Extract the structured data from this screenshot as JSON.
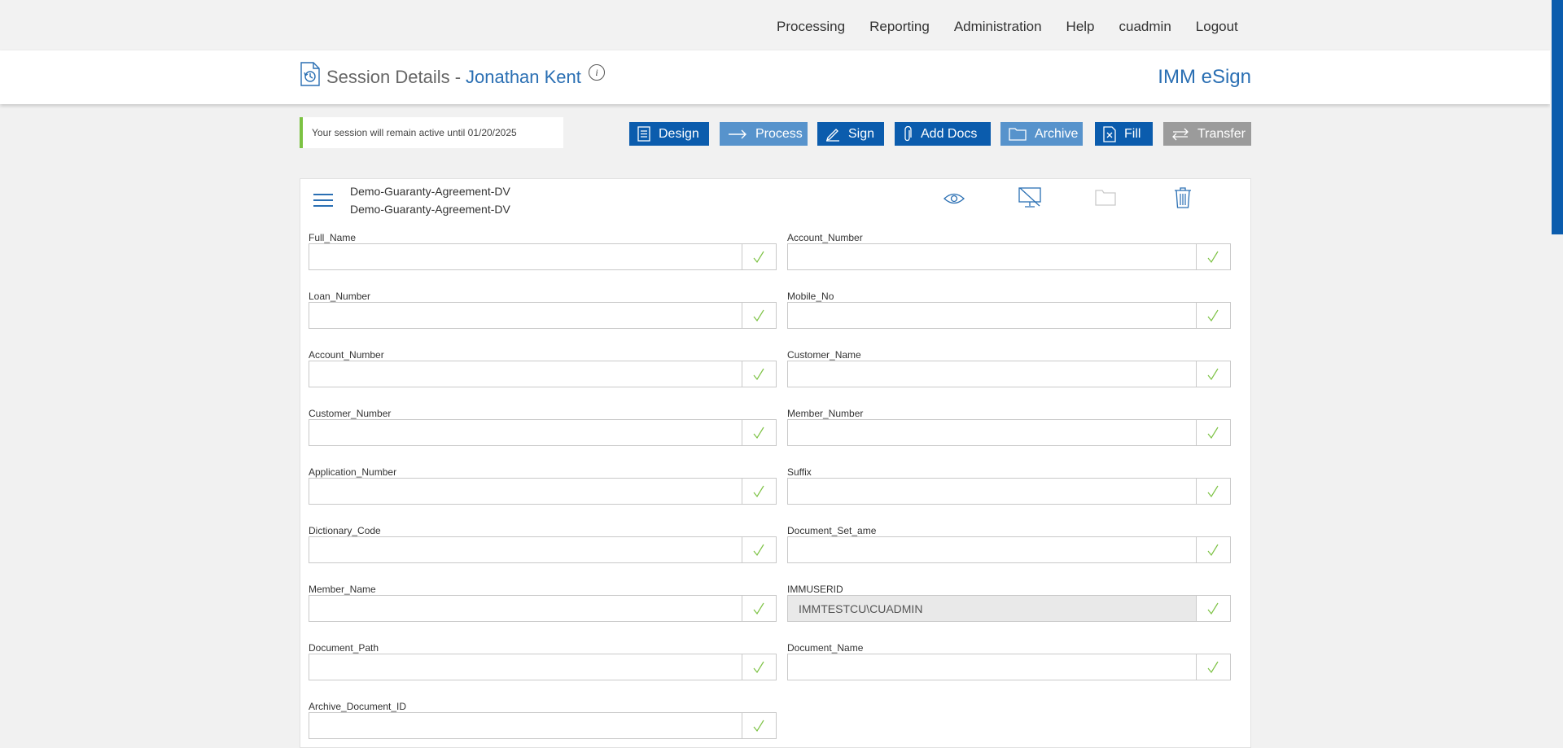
{
  "nav": [
    "Processing",
    "Reporting",
    "Administration",
    "Help",
    "cuadmin",
    "Logout"
  ],
  "header": {
    "title": "Session Details -",
    "name": "Jonathan Kent",
    "info": "i",
    "brand": "IMM eSign"
  },
  "notice": "Your session will remain active until 01/20/2025",
  "actions": {
    "design": "Design",
    "process": "Process",
    "sign": "Sign",
    "add_docs": "Add Docs",
    "archive": "Archive",
    "fill": "Fill",
    "transfer": "Transfer"
  },
  "document": {
    "name": "Demo-Guaranty-Agreement-DV",
    "subname": "Demo-Guaranty-Agreement-DV"
  },
  "fields": {
    "left": [
      {
        "label": "Full_Name",
        "value": ""
      },
      {
        "label": "Loan_Number",
        "value": ""
      },
      {
        "label": "Account_Number",
        "value": ""
      },
      {
        "label": "Customer_Number",
        "value": ""
      },
      {
        "label": "Application_Number",
        "value": ""
      },
      {
        "label": "Dictionary_Code",
        "value": ""
      },
      {
        "label": "Member_Name",
        "value": ""
      },
      {
        "label": "Document_Path",
        "value": ""
      },
      {
        "label": "Archive_Document_ID",
        "value": ""
      }
    ],
    "right": [
      {
        "label": "Account_Number",
        "value": ""
      },
      {
        "label": "Mobile_No",
        "value": ""
      },
      {
        "label": "Customer_Name",
        "value": ""
      },
      {
        "label": "Member_Number",
        "value": ""
      },
      {
        "label": "Suffix",
        "value": ""
      },
      {
        "label": "Document_Set_ame",
        "value": ""
      },
      {
        "label": "IMMUSERID",
        "value": "IMMTESTCU\\CUADMIN"
      },
      {
        "label": "Document_Name",
        "value": ""
      }
    ]
  },
  "icons": {
    "session": "session-history-icon",
    "design": "list-icon",
    "process": "arrow-right-icon",
    "sign": "pen-icon",
    "add_docs": "paperclip-icon",
    "archive": "folder-icon",
    "fill": "fill-form-icon",
    "transfer": "transfer-icon",
    "view": "eye-icon",
    "no_display": "monitor-off-icon",
    "folder": "folder-icon",
    "delete": "trash-icon",
    "check": "checkmark-icon",
    "menu": "hamburger-icon"
  },
  "colors": {
    "primary": "#0b5cad",
    "primary_light": "#5793cc",
    "disabled": "#9b9b9b",
    "link": "#2a6fb3",
    "notice_accent": "#7cc243",
    "check": "#7cc243"
  }
}
